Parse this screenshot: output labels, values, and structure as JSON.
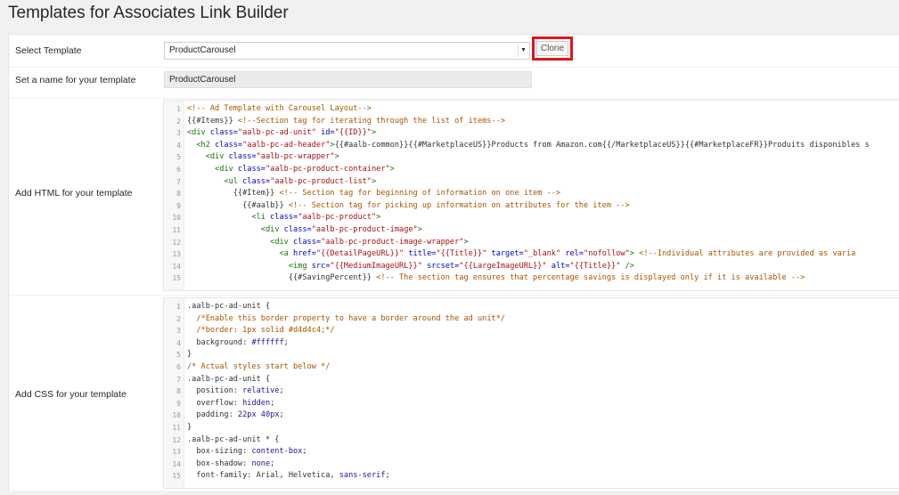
{
  "page": {
    "title": "Templates for Associates Link Builder"
  },
  "colors": {
    "highlight_border": "#e0141b",
    "input_readonly_bg": "#ebebeb"
  },
  "select_template": {
    "label": "Select Template",
    "value": "ProductCarousel",
    "arrow_icon": "caret-down-icon"
  },
  "clone_button": {
    "label": "Clone"
  },
  "template_name": {
    "label": "Set a name for your template",
    "value": "ProductCarousel"
  },
  "html_editor": {
    "label": "Add HTML for your template",
    "lines": [
      [
        [
          "cm",
          "<!-- Ad Template with Carousel Layout-->"
        ]
      ],
      [
        [
          "pr",
          "{{#Items}} "
        ],
        [
          "cm",
          "<!--Section tag for iterating through the list of items-->"
        ]
      ],
      [
        [
          "tg",
          "<div "
        ],
        [
          "at",
          "class="
        ],
        [
          "st",
          "\"aalb-pc-ad-unit\""
        ],
        [
          "at",
          " id="
        ],
        [
          "st",
          "\"{{ID}}\""
        ],
        [
          "tg",
          ">"
        ]
      ],
      [
        [
          "pr",
          "  "
        ],
        [
          "tg",
          "<h2 "
        ],
        [
          "at",
          "class="
        ],
        [
          "st",
          "\"aalb-pc-ad-header\""
        ],
        [
          "tg",
          ">"
        ],
        [
          "pr",
          "{{#aalb-common}}{{#MarketplaceUS}}Products from Amazon.com{{/MarketplaceUS}}{{#MarketplaceFR}}Produits disponibles s"
        ]
      ],
      [
        [
          "pr",
          "    "
        ],
        [
          "tg",
          "<div "
        ],
        [
          "at",
          "class="
        ],
        [
          "st",
          "\"aalb-pc-wrapper\""
        ],
        [
          "tg",
          ">"
        ]
      ],
      [
        [
          "pr",
          "      "
        ],
        [
          "tg",
          "<div "
        ],
        [
          "at",
          "class="
        ],
        [
          "st",
          "\"aalb-pc-product-container\""
        ],
        [
          "tg",
          ">"
        ]
      ],
      [
        [
          "pr",
          "        "
        ],
        [
          "tg",
          "<ul "
        ],
        [
          "at",
          "class="
        ],
        [
          "st",
          "\"aalb-pc-product-list\""
        ],
        [
          "tg",
          ">"
        ]
      ],
      [
        [
          "pr",
          "          {{#Item}} "
        ],
        [
          "cm",
          "<!-- Section tag for beginning of information on one item -->"
        ]
      ],
      [
        [
          "pr",
          "            {{#aalb}} "
        ],
        [
          "cm",
          "<!-- Section tag for picking up information on attributes for the item -->"
        ]
      ],
      [
        [
          "pr",
          "              "
        ],
        [
          "tg",
          "<li "
        ],
        [
          "at",
          "class="
        ],
        [
          "st",
          "\"aalb-pc-product\""
        ],
        [
          "tg",
          ">"
        ]
      ],
      [
        [
          "pr",
          "                "
        ],
        [
          "tg",
          "<div "
        ],
        [
          "at",
          "class="
        ],
        [
          "st",
          "\"aalb-pc-product-image\""
        ],
        [
          "tg",
          ">"
        ]
      ],
      [
        [
          "pr",
          "                  "
        ],
        [
          "tg",
          "<div "
        ],
        [
          "at",
          "class="
        ],
        [
          "st",
          "\"aalb-pc-product-image-wrapper\""
        ],
        [
          "tg",
          ">"
        ]
      ],
      [
        [
          "pr",
          "                    "
        ],
        [
          "tg",
          "<a "
        ],
        [
          "at",
          "href="
        ],
        [
          "st",
          "\"{{DetailPageURL}}\""
        ],
        [
          "at",
          " title="
        ],
        [
          "st",
          "\"{{Title}}\""
        ],
        [
          "at",
          " target="
        ],
        [
          "st",
          "\"_blank\""
        ],
        [
          "at",
          " rel="
        ],
        [
          "st",
          "\"nofollow\""
        ],
        [
          "tg",
          ">"
        ],
        [
          "cm",
          " <!--Individual attributes are provided as varia"
        ]
      ],
      [
        [
          "pr",
          "                      "
        ],
        [
          "tg",
          "<img "
        ],
        [
          "at",
          "src="
        ],
        [
          "st",
          "\"{{MediumImageURL}}\""
        ],
        [
          "at",
          " srcset="
        ],
        [
          "st",
          "\"{{LargeImageURL}}\""
        ],
        [
          "at",
          " alt="
        ],
        [
          "st",
          "\"{{Title}}\""
        ],
        [
          "tg",
          " />"
        ]
      ],
      [
        [
          "pr",
          "                      {{#SavingPercent}} "
        ],
        [
          "cm",
          "<!-- The section tag ensures that percentage savings is displayed only if it is available -->"
        ]
      ]
    ]
  },
  "css_editor": {
    "label": "Add CSS for your template",
    "lines": [
      [
        [
          "pr",
          ".aalb-pc-ad-unit {"
        ]
      ],
      [
        [
          "pr",
          "  "
        ],
        [
          "cm",
          "/*Enable this border property to have a border around the ad unit*/"
        ]
      ],
      [
        [
          "pr",
          "  "
        ],
        [
          "cm",
          "/*border: 1px solid #d4d4c4;*/"
        ]
      ],
      [
        [
          "pr",
          "  background: "
        ],
        [
          "vl",
          "#ffffff"
        ],
        [
          "pr",
          ";"
        ]
      ],
      [
        [
          "pr",
          "}"
        ]
      ],
      [
        [
          "cm",
          "/* Actual styles start below */"
        ]
      ],
      [
        [
          "pr",
          ".aalb-pc-ad-unit {"
        ]
      ],
      [
        [
          "pr",
          "  position: "
        ],
        [
          "vl",
          "relative"
        ],
        [
          "pr",
          ";"
        ]
      ],
      [
        [
          "pr",
          "  overflow: "
        ],
        [
          "vl",
          "hidden"
        ],
        [
          "pr",
          ";"
        ]
      ],
      [
        [
          "pr",
          "  padding: "
        ],
        [
          "vl",
          "22px 40px"
        ],
        [
          "pr",
          ";"
        ]
      ],
      [
        [
          "pr",
          "}"
        ]
      ],
      [
        [
          "pr",
          ".aalb-pc-ad-unit * {"
        ]
      ],
      [
        [
          "pr",
          "  box-sizing: "
        ],
        [
          "vl",
          "content-box"
        ],
        [
          "pr",
          ";"
        ]
      ],
      [
        [
          "pr",
          "  box-shadow: "
        ],
        [
          "vl",
          "none"
        ],
        [
          "pr",
          ";"
        ]
      ],
      [
        [
          "pr",
          "  font-family: Arial, Helvetica, "
        ],
        [
          "vl",
          "sans-serif"
        ],
        [
          "pr",
          ";"
        ]
      ]
    ]
  }
}
